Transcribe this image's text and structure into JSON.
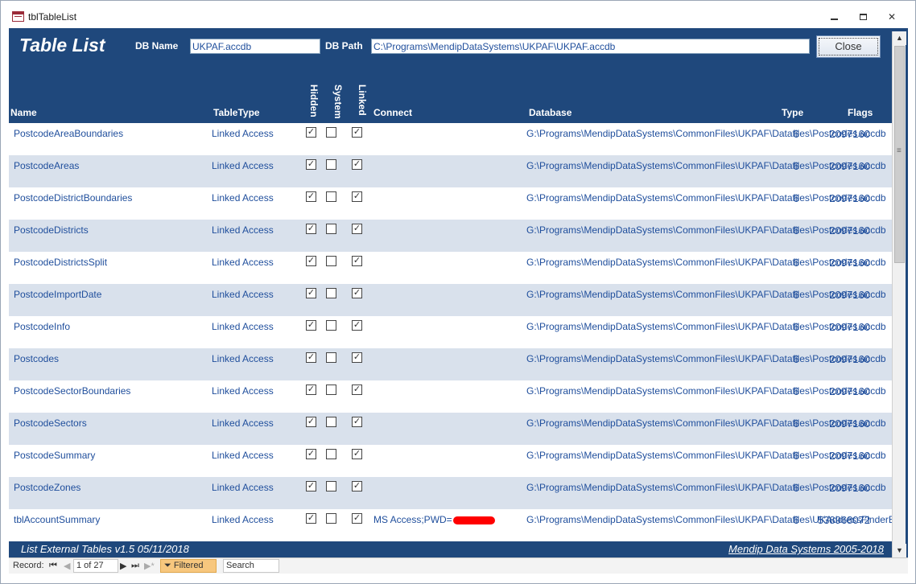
{
  "window": {
    "title": "tblTableList"
  },
  "header": {
    "title": "Table List",
    "db_name_label": "DB Name",
    "db_name_value": "UKPAF.accdb",
    "db_path_label": "DB Path",
    "db_path_value": "C:\\Programs\\MendipDataSystems\\UKPAF\\UKPAF.accdb",
    "close_label": "Close"
  },
  "columns": {
    "name": "Name",
    "table_type": "TableType",
    "hidden": "Hidden",
    "system": "System",
    "linked": "Linked",
    "connect": "Connect",
    "database": "Database",
    "type": "Type",
    "flags": "Flags"
  },
  "rows": [
    {
      "name": "PostcodeAreaBoundaries",
      "table_type": "Linked Access",
      "hidden": true,
      "system": false,
      "linked": true,
      "connect": "",
      "database": "G:\\Programs\\MendipDataSystems\\CommonFiles\\UKPAF\\Datafiles\\Postcodes.accdb",
      "type": "6",
      "flags": "2097160"
    },
    {
      "name": "PostcodeAreas",
      "table_type": "Linked Access",
      "hidden": true,
      "system": false,
      "linked": true,
      "connect": "",
      "database": "G:\\Programs\\MendipDataSystems\\CommonFiles\\UKPAF\\Datafiles\\Postcodes.accdb",
      "type": "6",
      "flags": "2097160"
    },
    {
      "name": "PostcodeDistrictBoundaries",
      "table_type": "Linked Access",
      "hidden": true,
      "system": false,
      "linked": true,
      "connect": "",
      "database": "G:\\Programs\\MendipDataSystems\\CommonFiles\\UKPAF\\Datafiles\\Postcodes.accdb",
      "type": "6",
      "flags": "2097160"
    },
    {
      "name": "PostcodeDistricts",
      "table_type": "Linked Access",
      "hidden": true,
      "system": false,
      "linked": true,
      "connect": "",
      "database": "G:\\Programs\\MendipDataSystems\\CommonFiles\\UKPAF\\Datafiles\\Postcodes.accdb",
      "type": "6",
      "flags": "2097160"
    },
    {
      "name": "PostcodeDistrictsSplit",
      "table_type": "Linked Access",
      "hidden": true,
      "system": false,
      "linked": true,
      "connect": "",
      "database": "G:\\Programs\\MendipDataSystems\\CommonFiles\\UKPAF\\Datafiles\\Postcodes.accdb",
      "type": "6",
      "flags": "2097160"
    },
    {
      "name": "PostcodeImportDate",
      "table_type": "Linked Access",
      "hidden": true,
      "system": false,
      "linked": true,
      "connect": "",
      "database": "G:\\Programs\\MendipDataSystems\\CommonFiles\\UKPAF\\Datafiles\\Postcodes.accdb",
      "type": "6",
      "flags": "2097160"
    },
    {
      "name": "PostcodeInfo",
      "table_type": "Linked Access",
      "hidden": true,
      "system": false,
      "linked": true,
      "connect": "",
      "database": "G:\\Programs\\MendipDataSystems\\CommonFiles\\UKPAF\\Datafiles\\Postcodes.accdb",
      "type": "6",
      "flags": "2097160"
    },
    {
      "name": "Postcodes",
      "table_type": "Linked Access",
      "hidden": true,
      "system": false,
      "linked": true,
      "connect": "",
      "database": "G:\\Programs\\MendipDataSystems\\CommonFiles\\UKPAF\\Datafiles\\Postcodes.accdb",
      "type": "6",
      "flags": "2097160"
    },
    {
      "name": "PostcodeSectorBoundaries",
      "table_type": "Linked Access",
      "hidden": true,
      "system": false,
      "linked": true,
      "connect": "",
      "database": "G:\\Programs\\MendipDataSystems\\CommonFiles\\UKPAF\\Datafiles\\Postcodes.accdb",
      "type": "6",
      "flags": "2097160"
    },
    {
      "name": "PostcodeSectors",
      "table_type": "Linked Access",
      "hidden": true,
      "system": false,
      "linked": true,
      "connect": "",
      "database": "G:\\Programs\\MendipDataSystems\\CommonFiles\\UKPAF\\Datafiles\\Postcodes.accdb",
      "type": "6",
      "flags": "2097160"
    },
    {
      "name": "PostcodeSummary",
      "table_type": "Linked Access",
      "hidden": true,
      "system": false,
      "linked": true,
      "connect": "",
      "database": "G:\\Programs\\MendipDataSystems\\CommonFiles\\UKPAF\\Datafiles\\Postcodes.accdb",
      "type": "6",
      "flags": "2097160"
    },
    {
      "name": "PostcodeZones",
      "table_type": "Linked Access",
      "hidden": true,
      "system": false,
      "linked": true,
      "connect": "",
      "database": "G:\\Programs\\MendipDataSystems\\CommonFiles\\UKPAF\\Datafiles\\Postcodes.accdb",
      "type": "6",
      "flags": "2097160"
    },
    {
      "name": "tblAccountSummary",
      "table_type": "Linked Access",
      "hidden": true,
      "system": false,
      "linked": true,
      "connect": "MS Access;PWD=",
      "redacted": true,
      "database": "G:\\Programs\\MendipDataSystems\\CommonFiles\\UKPAF\\Datafiles\\UKAddressFinderBE.accdb",
      "type": "6",
      "flags": "538968072"
    }
  ],
  "footer": {
    "left": "List External Tables   v1.5    05/11/2018",
    "right": "Mendip Data Systems 2005-2018"
  },
  "navbar": {
    "record_label": "Record:",
    "position": "1 of 27",
    "filtered_label": "Filtered",
    "search_label": "Search"
  },
  "colors": {
    "header_bg": "#1f487c",
    "alt_row": "#d9e1ec",
    "text_blue": "#1f4e9c",
    "filter_highlight": "#f7c77e"
  }
}
